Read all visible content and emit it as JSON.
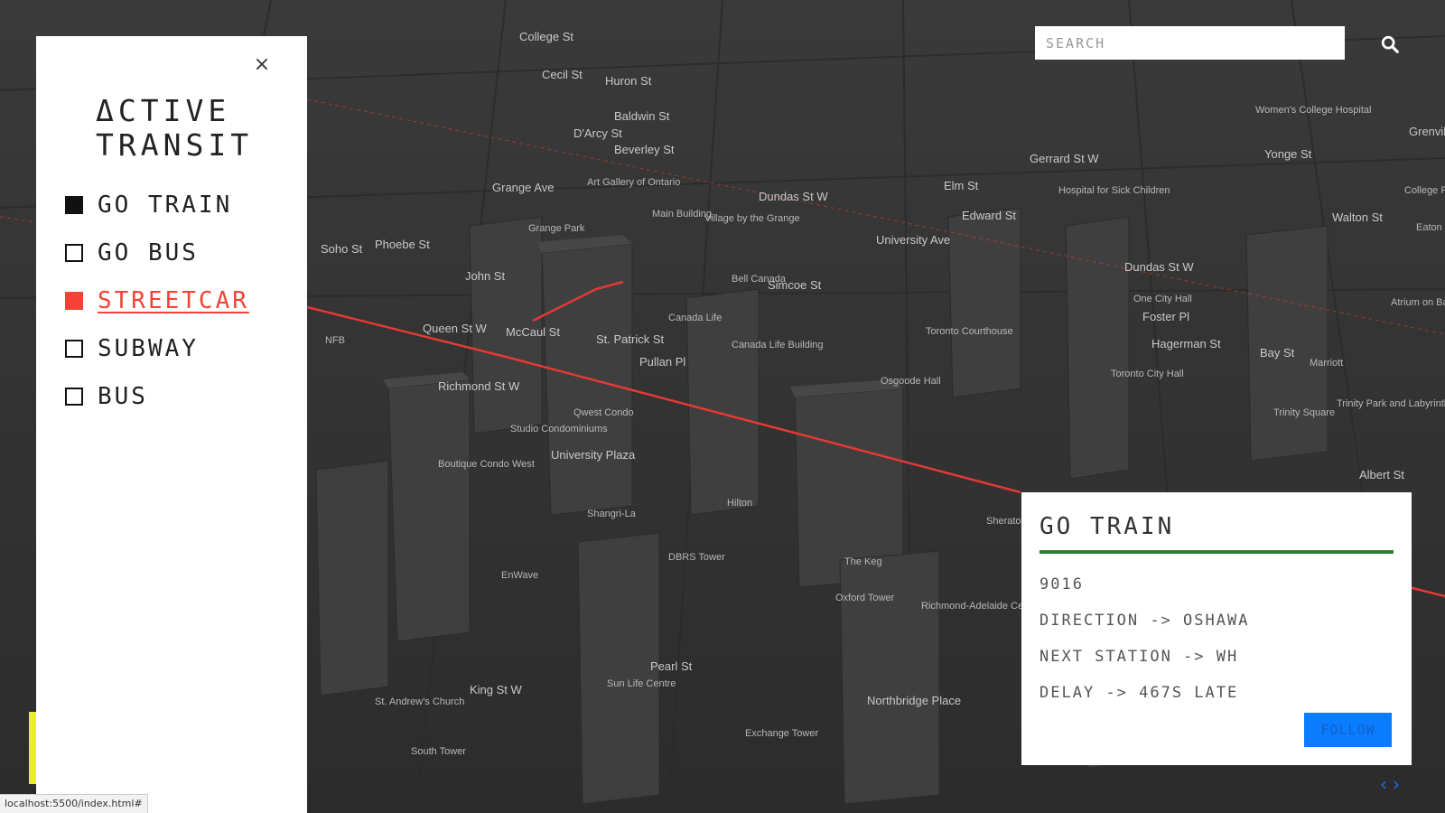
{
  "panel": {
    "title": "ΔCTIVE TRANSIT",
    "close_glyph": "×",
    "filters": [
      {
        "label": "GO TRAIN",
        "checked": true,
        "active": false
      },
      {
        "label": "GO BUS",
        "checked": false,
        "active": false
      },
      {
        "label": "STREETCAR",
        "checked": true,
        "active": true
      },
      {
        "label": "SUBWAY",
        "checked": false,
        "active": false
      },
      {
        "label": "BUS",
        "checked": false,
        "active": false
      }
    ]
  },
  "search": {
    "placeholder": "SEARCH",
    "value": ""
  },
  "card": {
    "title": "GO TRAIN",
    "vehicle_id": "9016",
    "direction": "DIRECTION -> OSHAWA",
    "next_station": "NEXT STATION -> WH",
    "delay": "DELAY -> 467S LATE",
    "follow_label": "FOLLOW",
    "rule_color": "#2e7d32"
  },
  "status_bar": {
    "url": "localhost:5500/index.html#"
  },
  "nav": {
    "prev": "‹",
    "next": "›"
  },
  "map": {
    "labels": [
      "College St",
      "Cecil St",
      "Huron St",
      "Baldwin St",
      "D'Arcy St",
      "Beverley St",
      "Grange Ave",
      "Grange Park",
      "Art Gallery of Ontario",
      "Dundas St W",
      "Queen St W",
      "Richmond St W",
      "John St",
      "Phoebe St",
      "Soho St",
      "Simcoe St",
      "University Ave",
      "Canada Life",
      "Canada Life Building",
      "Bell Canada",
      "Osgoode Hall",
      "Toronto Courthouse",
      "Toronto City Hall",
      "Hagerman St",
      "Edward St",
      "Elm St",
      "Gerrard St W",
      "Bay St",
      "Albert St",
      "Hilton",
      "Shangri-La",
      "DBRS Tower",
      "EnWave",
      "Sun Life Centre",
      "King St W",
      "Pearl St",
      "The Keg",
      "Oxford Tower",
      "Richmond-Adelaide Centre",
      "Northbridge Place",
      "Exchange Tower",
      "St. Andrew's Church",
      "South Tower",
      "Studio Condominiums",
      "Qwest Condo",
      "University Plaza",
      "Boutique Condo West",
      "Trinity Park and Labyrinth",
      "Trinity Square",
      "Marriott",
      "Walton St",
      "College Park",
      "Eaton Chelsea",
      "Atrium on Bay",
      "Sheraton Centre Toronto Hotel",
      "Pullan Pl",
      "McCaul St",
      "St. Patrick St",
      "Main Building",
      "Village by the Grange",
      "NFB",
      "Women's College Hospital",
      "Yonge St",
      "Grenville St",
      "One City Hall",
      "Foster Pl",
      "Dundas St W",
      "Hospital for Sick Children"
    ],
    "street_line_color": "#e53935"
  }
}
